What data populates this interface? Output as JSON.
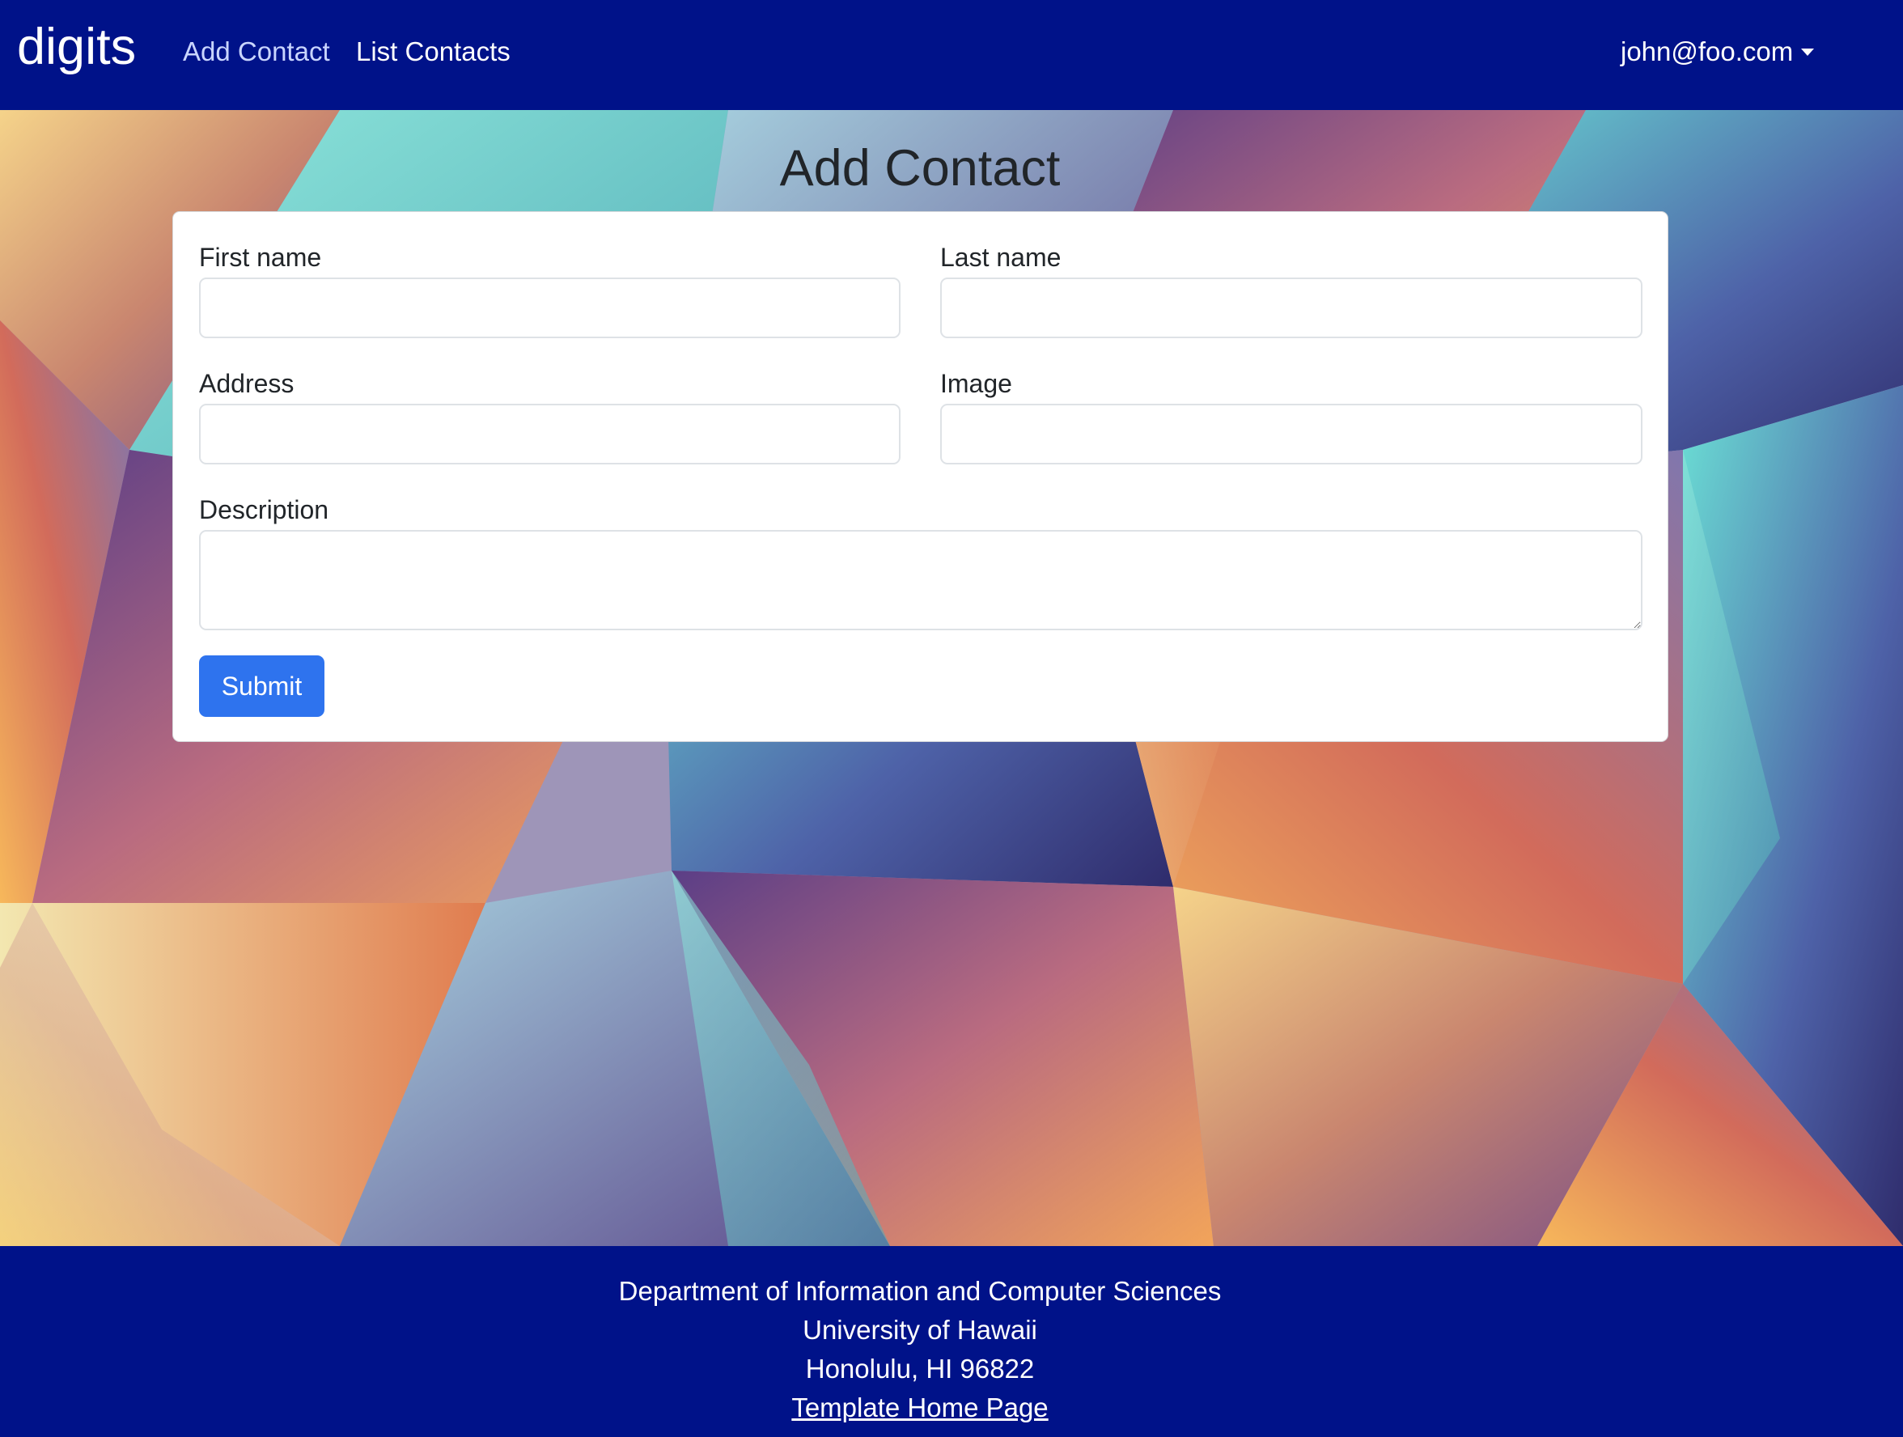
{
  "navbar": {
    "brand": "digits",
    "links": [
      {
        "label": "Add Contact",
        "active": true
      },
      {
        "label": "List Contacts",
        "active": false
      }
    ],
    "user": "john@foo.com"
  },
  "page": {
    "title": "Add Contact"
  },
  "form": {
    "first_name_label": "First name",
    "first_name_value": "",
    "last_name_label": "Last name",
    "last_name_value": "",
    "address_label": "Address",
    "address_value": "",
    "image_label": "Image",
    "image_value": "",
    "description_label": "Description",
    "description_value": "",
    "submit_label": "Submit"
  },
  "footer": {
    "lines": [
      "Department of Information and Computer Sciences",
      "University of Hawaii",
      "Honolulu, HI 96822"
    ],
    "link_label": "Template Home Page"
  },
  "colors": {
    "navbar_bg": "#001289",
    "footer_bg": "#001289",
    "submit_bg": "#2e73ee",
    "active_link": "#c9d5ff"
  }
}
